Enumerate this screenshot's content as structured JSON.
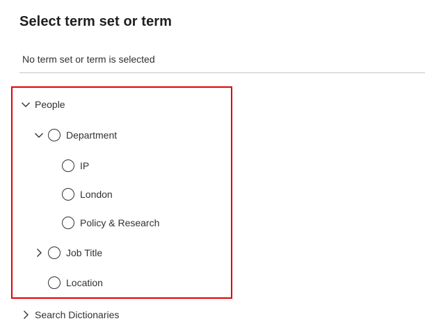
{
  "header": {
    "title": "Select term set or term"
  },
  "selection": {
    "status_text": "No term set or term is selected"
  },
  "tree": {
    "people": {
      "label": "People",
      "expanded": true
    },
    "department": {
      "label": "Department",
      "expanded": true
    },
    "ip": {
      "label": "IP"
    },
    "london": {
      "label": "London"
    },
    "policy_research": {
      "label": "Policy & Research"
    },
    "job_title": {
      "label": "Job Title",
      "expanded": false
    },
    "location": {
      "label": "Location"
    },
    "search_dictionaries": {
      "label": "Search Dictionaries",
      "expanded": false
    }
  },
  "colors": {
    "highlight": "#e00000",
    "text": "#323130",
    "divider": "#c8c6c4"
  },
  "icons": {
    "expanded": "chevron-down-icon",
    "collapsed": "chevron-right-icon",
    "select": "radio-circle-icon"
  }
}
